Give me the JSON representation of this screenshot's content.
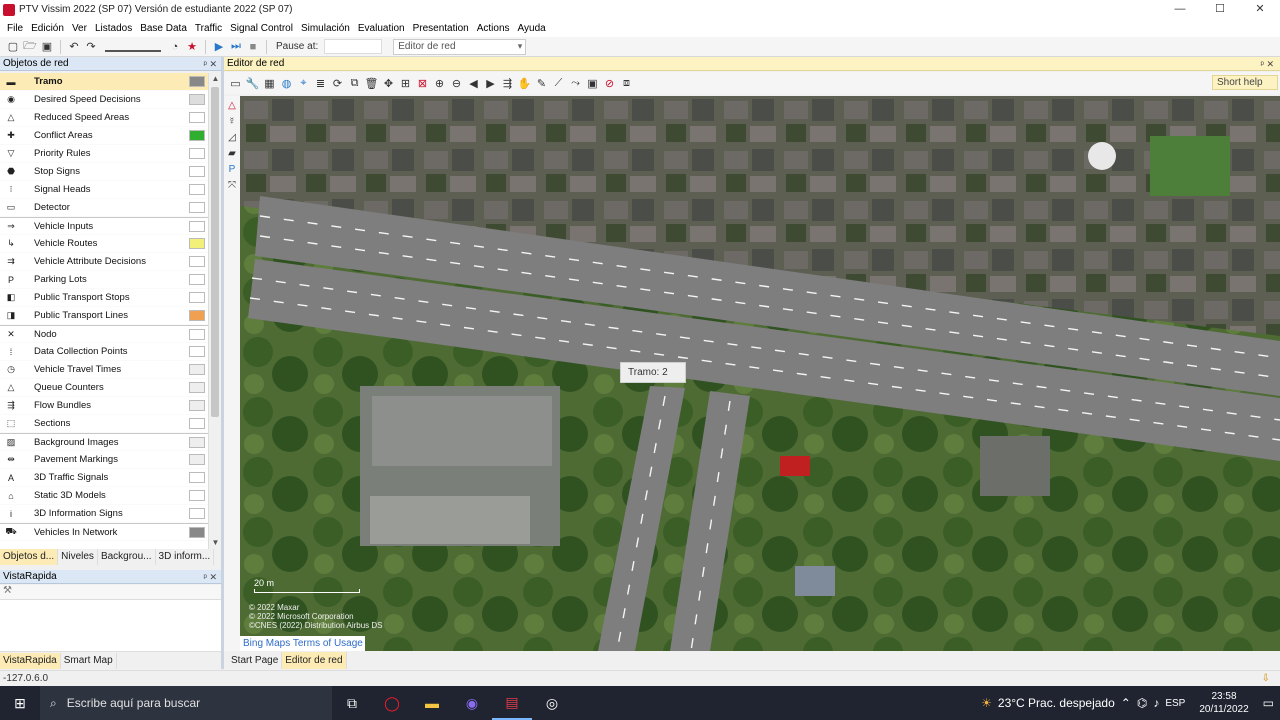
{
  "window": {
    "title": "PTV Vissim 2022 (SP 07) Versión de estudiante 2022 (SP 07)",
    "controls": [
      "—",
      "☐",
      "✕"
    ]
  },
  "menu": [
    "File",
    "Edición",
    "Ver",
    "Listados",
    "Base Data",
    "Traffic",
    "Signal Control",
    "Simulación",
    "Evaluation",
    "Presentation",
    "Actions",
    "Ayuda"
  ],
  "toolbar": {
    "pause_label": "Pause at:",
    "pause_value": "",
    "view_select": "Editor de red"
  },
  "objects_panel": {
    "title": "Objetos de red",
    "items": [
      {
        "label": "Tramo",
        "icon": "link-icon",
        "swatch": "#888888",
        "selected": true
      },
      {
        "label": "Desired Speed Decisions",
        "icon": "speed-sign-icon",
        "swatch": "#dddddd"
      },
      {
        "label": "Reduced Speed Areas",
        "icon": "warning-triangle-icon",
        "swatch": "#ffffff"
      },
      {
        "label": "Conflict Areas",
        "icon": "conflict-icon",
        "swatch": "#2fae2f"
      },
      {
        "label": "Priority Rules",
        "icon": "priority-icon",
        "swatch": "#ffffff"
      },
      {
        "label": "Stop Signs",
        "icon": "stop-sign-icon",
        "swatch": "#ffffff"
      },
      {
        "label": "Signal Heads",
        "icon": "traffic-light-icon",
        "swatch": "#ffffff"
      },
      {
        "label": "Detector",
        "icon": "detector-icon",
        "swatch": "#ffffff"
      },
      {
        "label": "Vehicle Inputs",
        "icon": "vehicle-input-icon",
        "swatch": "#ffffff",
        "group_start": true
      },
      {
        "label": "Vehicle Routes",
        "icon": "route-icon",
        "swatch": "#f3f07a"
      },
      {
        "label": "Vehicle Attribute Decisions",
        "icon": "attribute-icon",
        "swatch": "#ffffff"
      },
      {
        "label": "Parking Lots",
        "icon": "parking-icon",
        "swatch": "#ffffff"
      },
      {
        "label": "Public Transport Stops",
        "icon": "pt-stop-icon",
        "swatch": "#ffffff"
      },
      {
        "label": "Public Transport Lines",
        "icon": "pt-line-icon",
        "swatch": "#f0a050"
      },
      {
        "label": "Nodo",
        "icon": "node-icon",
        "swatch": "#ffffff",
        "group_start": true
      },
      {
        "label": "Data Collection Points",
        "icon": "data-point-icon",
        "swatch": "#ffffff"
      },
      {
        "label": "Vehicle Travel Times",
        "icon": "travel-time-icon",
        "swatch": "#eeeeee"
      },
      {
        "label": "Queue Counters",
        "icon": "queue-icon",
        "swatch": "#eeeeee"
      },
      {
        "label": "Flow Bundles",
        "icon": "flow-bundle-icon",
        "swatch": "#eeeeee"
      },
      {
        "label": "Sections",
        "icon": "section-icon",
        "swatch": "#ffffff"
      },
      {
        "label": "Background Images",
        "icon": "image-icon",
        "swatch": "#eeeeee",
        "group_start": true
      },
      {
        "label": "Pavement Markings",
        "icon": "marking-icon",
        "swatch": "#eeeeee"
      },
      {
        "label": "3D Traffic Signals",
        "icon": "signal-3d-icon",
        "swatch": "#ffffff"
      },
      {
        "label": "Static 3D Models",
        "icon": "model-3d-icon",
        "swatch": "#ffffff"
      },
      {
        "label": "3D Information Signs",
        "icon": "info-sign-icon",
        "swatch": "#ffffff"
      },
      {
        "label": "Vehicles In Network",
        "icon": "vehicles-icon",
        "swatch": "#888888",
        "group_start": true
      }
    ],
    "tabs": [
      "Objetos d...",
      "Niveles",
      "Backgrou...",
      "3D inform..."
    ]
  },
  "vista_panel": {
    "title": "VistaRapida",
    "tabs": [
      "VistaRapida",
      "Smart Map"
    ]
  },
  "editor": {
    "title": "Editor de red",
    "short_help": "Short help",
    "tooltip": "Tramo:  2",
    "scale_label": "20 m",
    "copyright": [
      "© 2022 Maxar",
      "© 2022 Microsoft Corporation",
      "©CNES (2022) Distribution Airbus DS"
    ],
    "bing_link": "Bing Maps Terms of Usage",
    "tabs": [
      "Start Page",
      "Editor de red"
    ]
  },
  "status": {
    "coords": "-127.0.6.0"
  },
  "taskbar": {
    "search_placeholder": "Escribe aquí para buscar",
    "weather": "23°C  Prac. despejado",
    "language": "ESP",
    "time": "23:58",
    "date": "20/11/2022"
  }
}
